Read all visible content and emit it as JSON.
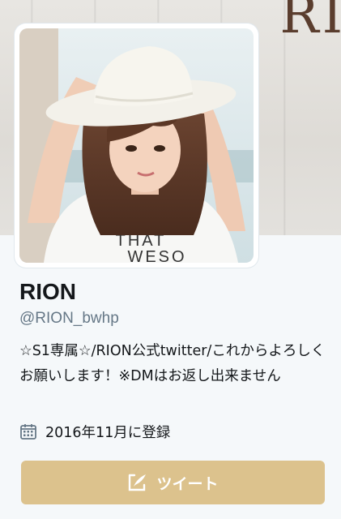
{
  "profile": {
    "name": "RION",
    "handle": "@RION_bwhp",
    "bio": "☆S1専属☆/RION公式twitter/これからよろしくお願いします！※DMはお返し出来ません",
    "joined": "2016年11月に登録"
  },
  "banner": {
    "letters": "RI"
  },
  "avatar": {
    "shirt_text_line1": "THAT",
    "shirt_text_line2": "WESO"
  },
  "actions": {
    "tweet_label": "ツイート"
  },
  "icons": {
    "joined": "calendar-icon",
    "tweet": "quill-icon"
  },
  "colors": {
    "tweet_button": "#dcc28d",
    "handle": "#657786",
    "text": "#14171a",
    "background": "#f5f8fa"
  }
}
